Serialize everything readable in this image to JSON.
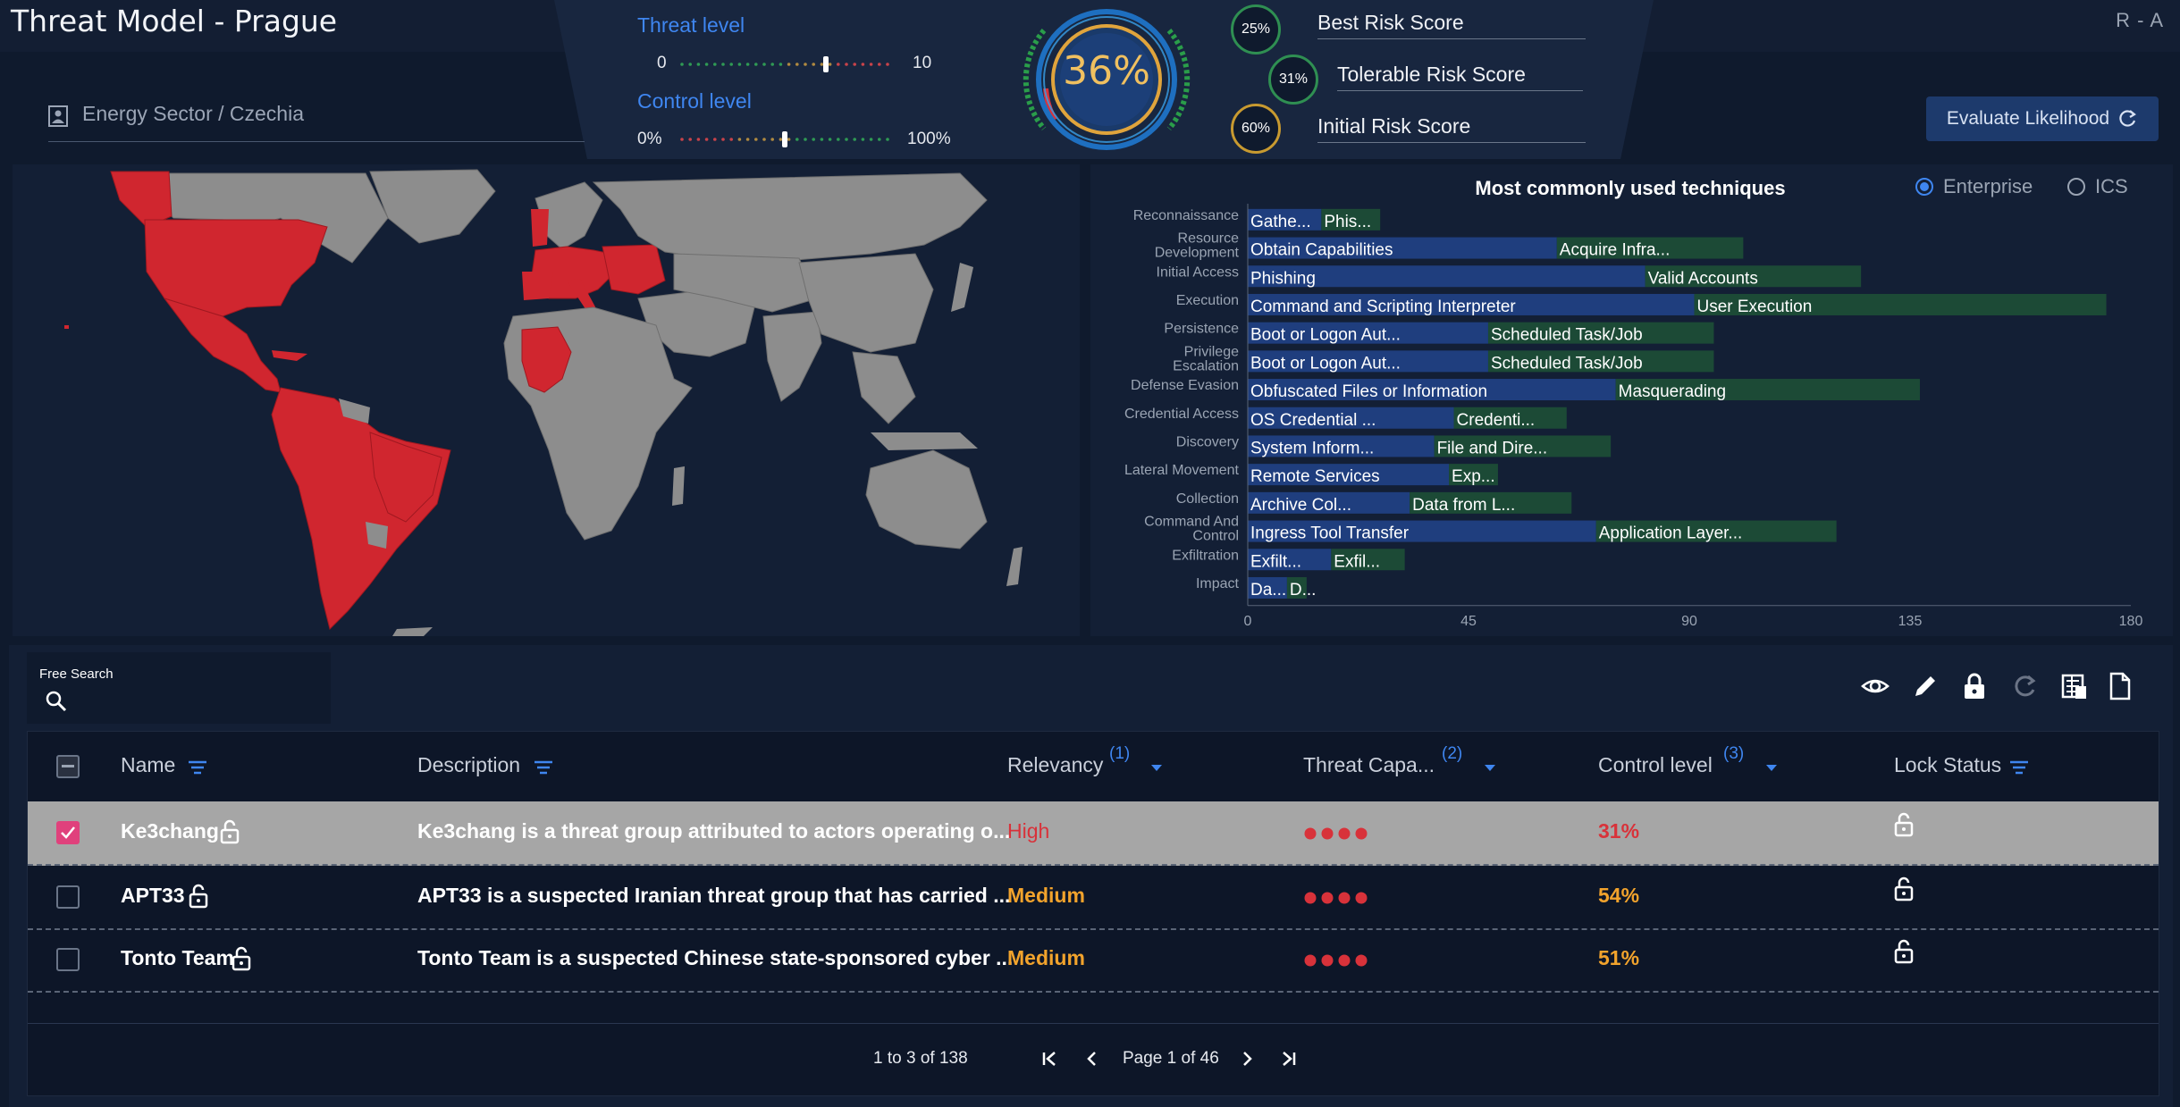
{
  "header": {
    "title": "Threat Model  -  Prague",
    "right_label": "R - A"
  },
  "organization": {
    "label": "Energy Sector / Czechia"
  },
  "threat_level": {
    "title": "Threat level",
    "min_label": "0",
    "max_label": "10",
    "value": 7
  },
  "control_level": {
    "title": "Control level",
    "min_label": "0%",
    "max_label": "100%",
    "value": 0.5
  },
  "gauge": {
    "value_text": "36%"
  },
  "scores": [
    {
      "pct": "25%",
      "label": "Best Risk Score",
      "color": "#2f8f52"
    },
    {
      "pct": "31%",
      "label": "Tolerable Risk Score",
      "color": "#2f8f52"
    },
    {
      "pct": "60%",
      "label": "Initial Risk Score",
      "color": "#c89a30"
    }
  ],
  "evaluate_button": {
    "label": "Evaluate Likelihood"
  },
  "chart_options": {
    "enterprise": "Enterprise",
    "ics": "ICS",
    "selected": "Enterprise"
  },
  "chart_data": {
    "type": "bar",
    "orientation": "horizontal",
    "stacked": true,
    "title": "Most commonly used techniques",
    "categories": [
      "Reconnaissance",
      "Resource Development",
      "Initial Access",
      "Execution",
      "Persistence",
      "Privilege Escalation",
      "Defense Evasion",
      "Credential Access",
      "Discovery",
      "Lateral Movement",
      "Collection",
      "Command And Control",
      "Exfiltration",
      "Impact"
    ],
    "series": [
      {
        "name": "",
        "color": "#1f3e7e",
        "values": [
          15,
          63,
          81,
          91,
          49,
          49,
          75,
          42,
          38,
          41,
          33,
          71,
          17,
          8
        ],
        "labels": [
          "Gathe...",
          "Obtain Capabilities",
          "Phishing",
          "Command and Scripting Interpreter",
          "Boot or Logon Aut...",
          "Boot or Logon Aut...",
          "Obfuscated Files or Information",
          "OS Credential ...",
          "System Inform...",
          "Remote Services",
          "Archive Col...",
          "Ingress Tool Transfer",
          "Exfilt...",
          "Da..."
        ]
      },
      {
        "name": "",
        "color": "#1c4a36",
        "values": [
          12,
          38,
          44,
          84,
          46,
          46,
          62,
          23,
          36,
          10,
          33,
          49,
          15,
          4
        ],
        "labels": [
          "Phis...",
          "Acquire Infra...",
          "Valid Accounts",
          "User Execution",
          "Scheduled Task/Job",
          "Scheduled Task/Job",
          "Masquerading",
          "Credenti...",
          "File and Dire...",
          "Exp...",
          "Data from L...",
          "Application Layer...",
          "Exfil...",
          "D..."
        ]
      }
    ],
    "xlim": [
      0,
      180
    ],
    "xticks": [
      "0",
      "45",
      "90",
      "135",
      "180"
    ]
  },
  "search": {
    "label": "Free Search",
    "placeholder": ""
  },
  "table": {
    "headers": {
      "name": "Name",
      "description": "Description",
      "relevancy": "Relevancy",
      "relevancy_num": "(1)",
      "threat": "Threat Capa...",
      "threat_num": "(2)",
      "control": "Control level",
      "control_num": "(3)",
      "lock": "Lock Status"
    },
    "rows": [
      {
        "name": "Ke3chang",
        "description": "Ke3chang is a threat group attributed to actors operating o...",
        "relevancy": "High",
        "relevancy_color": "#d8323a",
        "control": "31%",
        "control_color": "#d8323a",
        "threat_dots": 4,
        "selected": true
      },
      {
        "name": "APT33",
        "description": "APT33 is a suspected Iranian threat group that has carried ...",
        "relevancy": "Medium",
        "relevancy_color": "#f2a32c",
        "control": "54%",
        "control_color": "#f2a32c",
        "threat_dots": 4,
        "selected": false
      },
      {
        "name": "Tonto Team",
        "description": "Tonto Team is a suspected Chinese state-sponsored cyber ...",
        "relevancy": "Medium",
        "relevancy_color": "#f2a32c",
        "control": "51%",
        "control_color": "#f2a32c",
        "threat_dots": 4,
        "selected": false
      }
    ]
  },
  "pagination": {
    "range": "1 to 3 of 138",
    "page": "Page 1 of 46"
  }
}
